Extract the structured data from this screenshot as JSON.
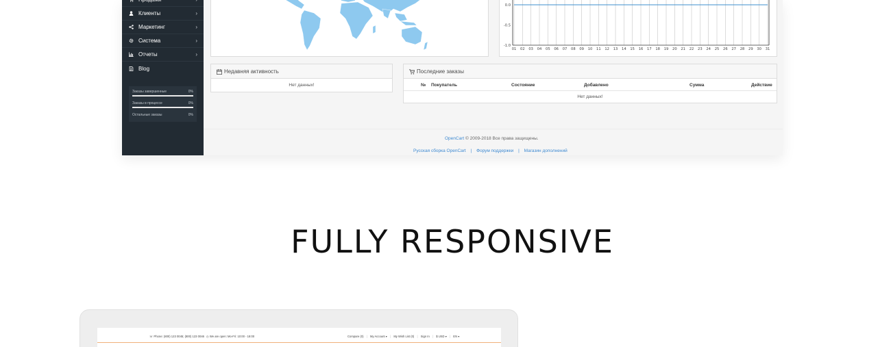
{
  "sidebar": {
    "items": [
      {
        "label": "Продажи",
        "icon": "cart-icon"
      },
      {
        "label": "Клиенты",
        "icon": "user-icon"
      },
      {
        "label": "Маркетинг",
        "icon": "share-icon"
      },
      {
        "label": "Система",
        "icon": "gear-icon"
      },
      {
        "label": "Отчеты",
        "icon": "bar-chart-icon"
      },
      {
        "label": "Blog",
        "icon": "document-icon"
      }
    ],
    "chevron": "›",
    "stats": [
      {
        "label": "Заказы завершенные",
        "value": "0%"
      },
      {
        "label": "Заказы в процессе",
        "value": "0%"
      },
      {
        "label": "Остальные заказы",
        "value": "0%"
      }
    ]
  },
  "chart_data": {
    "type": "line",
    "x": [
      "01",
      "02",
      "03",
      "04",
      "05",
      "06",
      "07",
      "08",
      "09",
      "10",
      "11",
      "12",
      "13",
      "14",
      "15",
      "16",
      "17",
      "18",
      "19",
      "20",
      "21",
      "22",
      "23",
      "24",
      "25",
      "26",
      "27",
      "28",
      "29",
      "30",
      "31"
    ],
    "y_ticks": [
      "0.0",
      "-0.5",
      "-1.0"
    ],
    "series": [
      {
        "values": [
          0,
          0,
          0,
          0,
          0,
          0,
          0,
          0,
          0,
          0,
          0,
          0,
          0,
          0,
          0,
          0,
          0,
          0,
          0,
          0,
          0,
          0,
          0,
          0,
          0,
          0,
          0,
          0,
          0,
          0,
          0
        ]
      }
    ],
    "ylim": [
      -1.0,
      0.0
    ],
    "grid": true,
    "colors": {
      "line": "#3d8fcc"
    }
  },
  "activity": {
    "title": "Недавняя активность",
    "empty": "Нет данных!"
  },
  "orders": {
    "title": "Последние заказы",
    "columns": [
      "№",
      "Покупатель",
      "Состояние",
      "Добавлено",
      "Сумма",
      "Действие"
    ],
    "empty": "Нет данных!"
  },
  "footer": {
    "brand": "OpenCart",
    "copyright": "© 2009-2018 Все права защищены.",
    "links": [
      "Русская сборка OpenCart",
      "Форум поддержки",
      "Магазин дополнений"
    ],
    "separator": "|"
  },
  "headline": "FULLY RESPONSIVE",
  "mockup": {
    "phone": "Phone: (800) 123 0045; (800) 123 0046",
    "hours": "We are open: Mo-Fri: 10:00 - 18:00",
    "nav": [
      "Compare (0)",
      "My Account ▾",
      "My Wish List (0)",
      "Sign In",
      "$ USD ▾",
      "EN ▾"
    ]
  },
  "colors": {
    "sidebar_bg": "#222b33",
    "map": "#8ec9ef",
    "link": "#3f8ad1",
    "accent_orange": "#f0b07a"
  }
}
